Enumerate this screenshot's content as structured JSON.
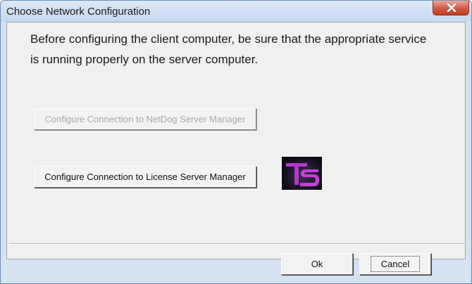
{
  "window": {
    "title": "Choose Network Configuration"
  },
  "message": {
    "line1": "Before configuring the client computer, be sure that the appropriate service",
    "line2": "is running properly on the server computer."
  },
  "buttons": {
    "netdog": {
      "label": "Configure Connection to NetDog Server Manager",
      "enabled": false
    },
    "license": {
      "label": "Configure Connection to License Server Manager",
      "enabled": true
    },
    "ok": {
      "label": "Ok"
    },
    "cancel": {
      "label": "Cancel",
      "focused": true
    }
  },
  "icons": {
    "close": "close-icon",
    "logo": "ts-logo-icon"
  },
  "colors": {
    "logo_accent": "#c341d8",
    "close_button": "#c9462f"
  }
}
